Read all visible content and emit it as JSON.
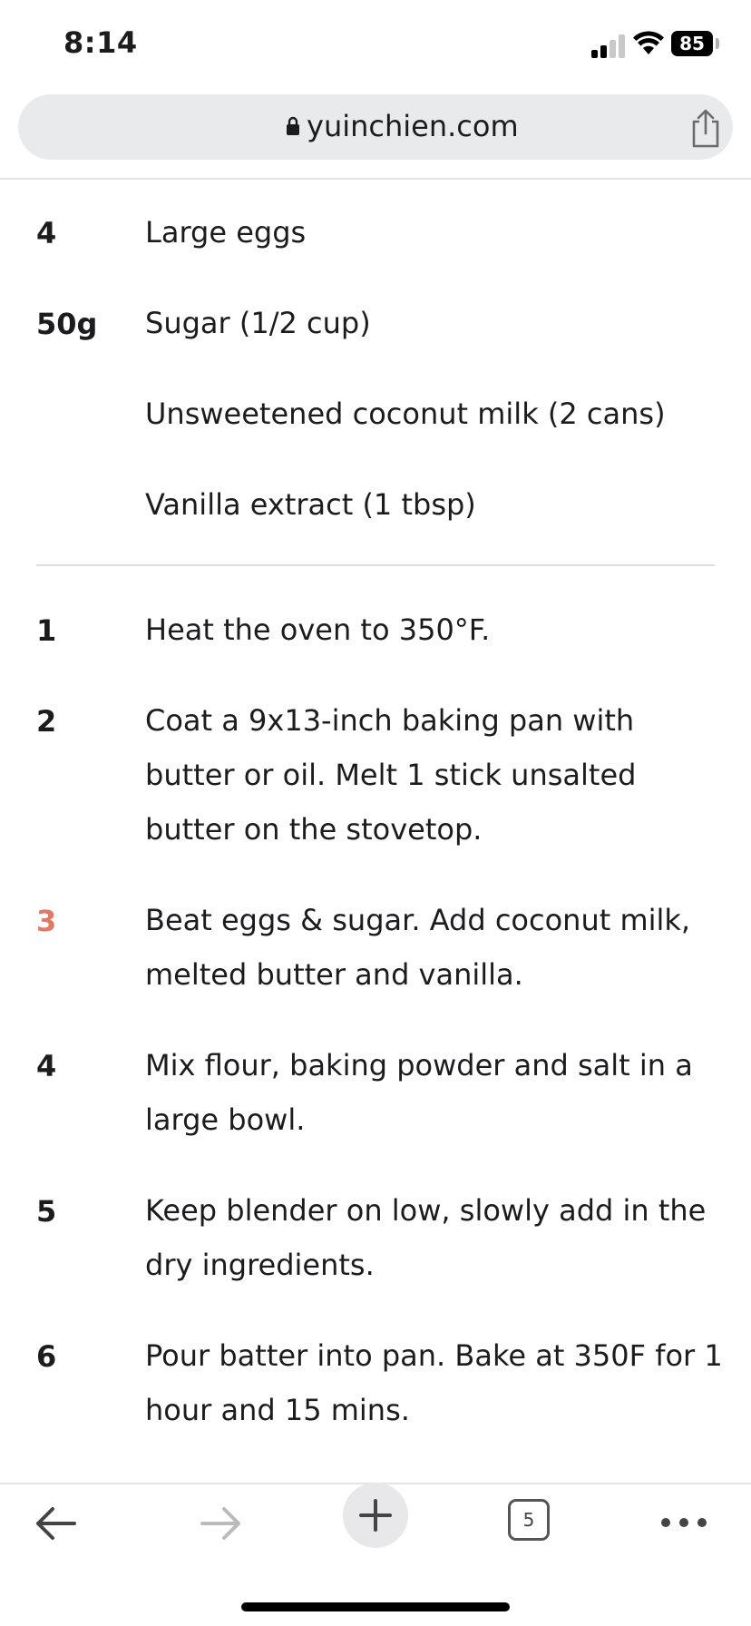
{
  "status_bar": {
    "time": "8:14",
    "battery": "85"
  },
  "browser": {
    "url": "yuinchien.com"
  },
  "ingredients": [
    {
      "qty": "4",
      "name": "Large eggs"
    },
    {
      "qty": "50g",
      "name": "Sugar (1/2 cup)"
    },
    {
      "qty": "",
      "name": "Unsweetened coconut milk (2 cans)"
    },
    {
      "qty": "",
      "name": "Vanilla extract (1 tbsp)"
    }
  ],
  "steps": [
    {
      "num": "1",
      "text": "Heat the oven to 350°F."
    },
    {
      "num": "2",
      "text": "Coat a 9x13-inch baking pan with butter or oil. Melt 1 stick unsalted butter on the stovetop."
    },
    {
      "num": "3",
      "text": "Beat eggs & sugar. Add coconut milk, melted butter and vanilla."
    },
    {
      "num": "4",
      "text": "Mix flour, baking powder and salt in a large bowl."
    },
    {
      "num": "5",
      "text": "Keep blender on low, slowly add in the dry ingredients."
    },
    {
      "num": "6",
      "text": "Pour batter into pan. Bake at 350F for 1 hour and 15 mins."
    }
  ],
  "toolbar": {
    "tab_count": "5"
  },
  "colors": {
    "active_step": "#e07a66",
    "url_bar_bg": "#e9eaec"
  }
}
